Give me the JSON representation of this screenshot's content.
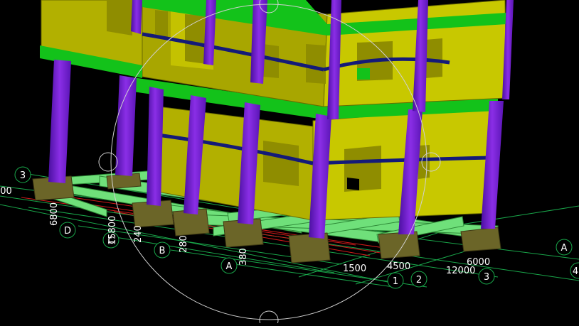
{
  "viewport": {
    "view_mode": "3D structural model",
    "colors": {
      "background": "#000000",
      "wall": "#c8c800",
      "wall_shade": "#9e9e00",
      "slab_band": "#13c21a",
      "column": "#7a1fd6",
      "beam": "#141a78",
      "grade_beam": "#6fe07a",
      "footing": "#6b6528",
      "grid_green": "#19a64a",
      "grid_red": "#d01a1a",
      "orbit_circle": "#d0d0d0"
    },
    "grid_bubbles": [
      {
        "label": "3"
      },
      {
        "label": "D"
      },
      {
        "label": "C"
      },
      {
        "label": "B"
      },
      {
        "label": "A"
      },
      {
        "label": "1"
      },
      {
        "label": "2"
      },
      {
        "label": "3"
      },
      {
        "label": "A"
      },
      {
        "label": "4"
      }
    ],
    "dimensions": [
      {
        "text": "000"
      },
      {
        "text": "6800"
      },
      {
        "text": "15800"
      },
      {
        "text": "240"
      },
      {
        "text": "280"
      },
      {
        "text": "380"
      },
      {
        "text": "1500"
      },
      {
        "text": "4500"
      },
      {
        "text": "12000"
      },
      {
        "text": "6000"
      }
    ],
    "icons": [
      "orbit-circle-icon"
    ]
  }
}
